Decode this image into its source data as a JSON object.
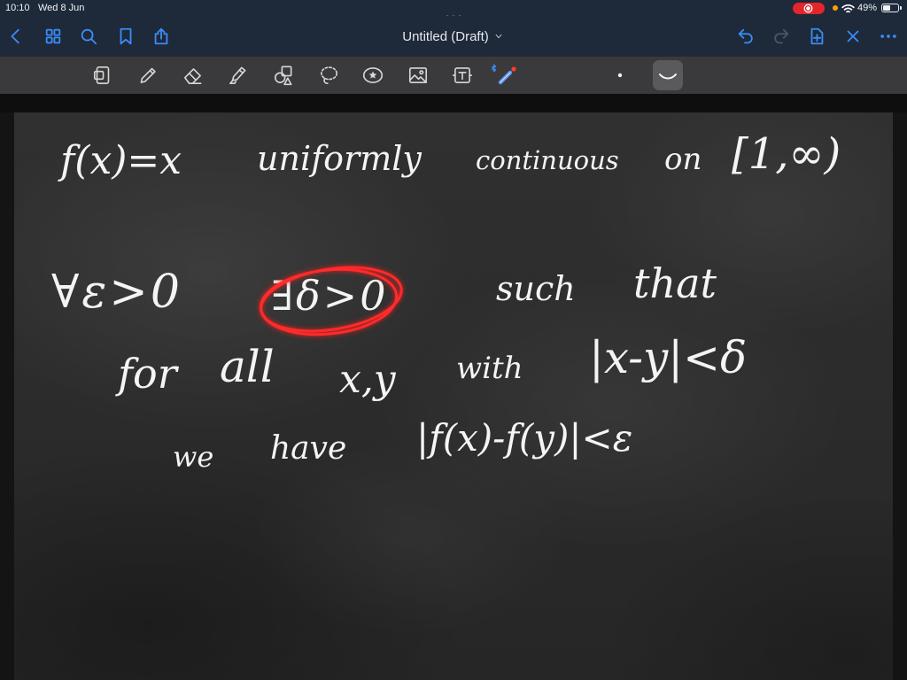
{
  "status_bar": {
    "time": "10:10",
    "date": "Wed 8 Jun",
    "battery_percent": "49%",
    "battery_level": 0.49,
    "icons": [
      "multitasking-dots-icon",
      "screen-recording-icon",
      "microphone-indicator-icon",
      "wifi-icon",
      "battery-icon"
    ]
  },
  "nav_bar": {
    "title": "Untitled (Draft)",
    "left_icons": [
      "back-icon",
      "thumbnails-grid-icon",
      "search-icon",
      "bookmark-icon",
      "share-icon"
    ],
    "right_icons": [
      "undo-icon",
      "redo-icon",
      "add-page-icon",
      "close-icon",
      "more-icon"
    ],
    "redo_enabled": false
  },
  "toolbar": {
    "tools": [
      "zoom-window-icon",
      "pen-icon",
      "eraser-icon",
      "highlighter-icon",
      "shapes-icon",
      "lasso-icon",
      "sticker-icon",
      "image-icon",
      "text-box-icon",
      "laser-pointer-icon"
    ],
    "options": [
      "pen-size-icon",
      "stroke-style-icon"
    ],
    "selected_option": "stroke-style-icon"
  },
  "page": {
    "background": "chalkboard",
    "ink_color": "#f4f4f4",
    "lines": [
      {
        "words": [
          "f(x)=x",
          "uniformly",
          "continuous",
          "on",
          "[1,∞)"
        ]
      },
      {
        "words": [
          "∀ε>0",
          "∃δ>0",
          "such",
          "that"
        ]
      },
      {
        "words": [
          "for",
          "all",
          "x,y",
          "with",
          "|x-y|<δ"
        ]
      },
      {
        "words": [
          "we",
          "have",
          "|f(x)-f(y)|<ε"
        ]
      }
    ],
    "highlight": {
      "line": 1,
      "word": 1,
      "color": "#ff2a2a"
    }
  },
  "colors": {
    "accent": "#3b8cf5",
    "nav_bg": "#1e293a",
    "toolbar_bg": "#3a3a3c",
    "record": "#e3262b",
    "mic_indicator": "#ff9f0a",
    "laser_dot": "#ff3b30"
  }
}
